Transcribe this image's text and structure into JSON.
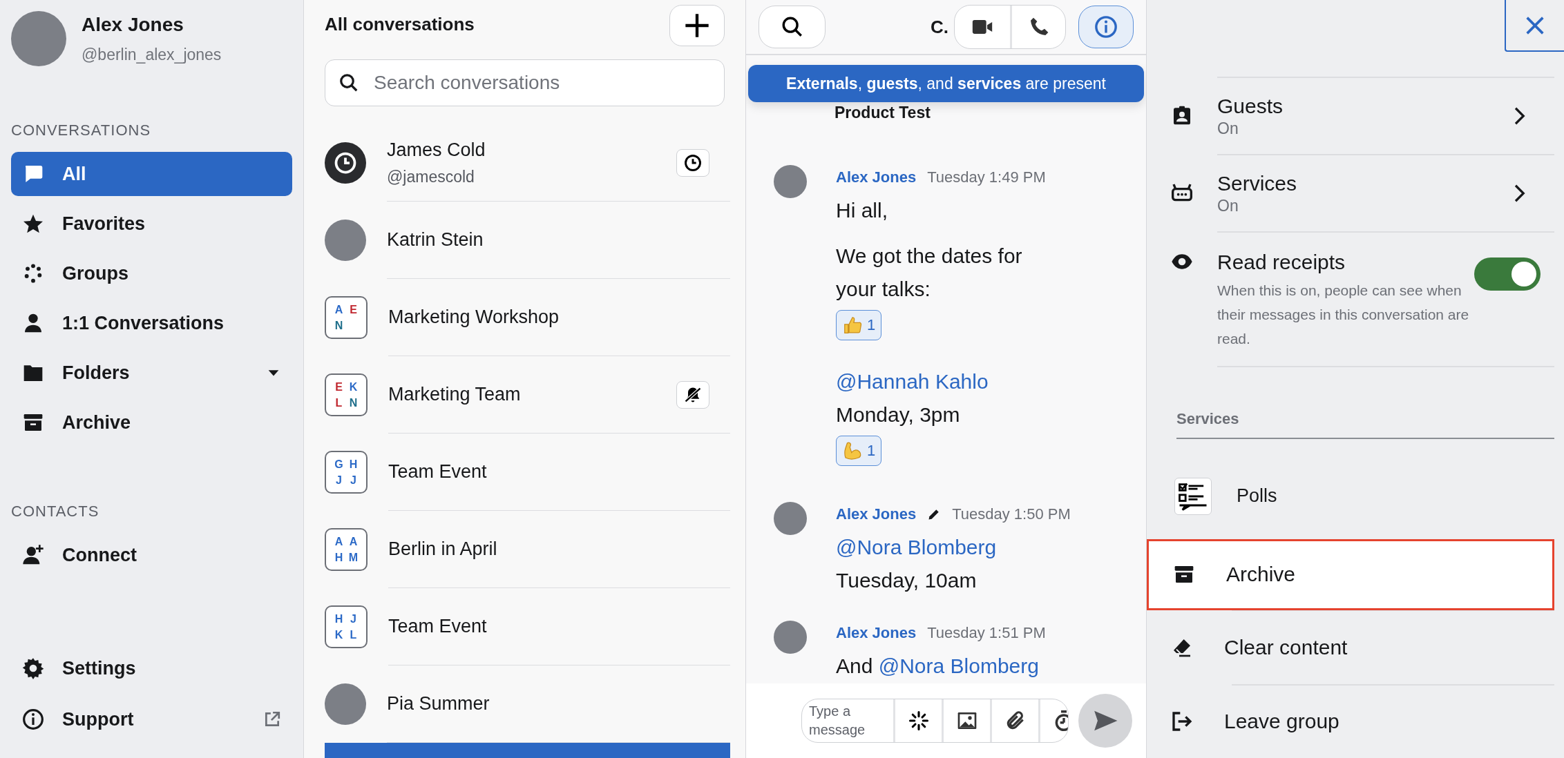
{
  "profile": {
    "name": "Alex Jones",
    "handle": "@berlin_alex_jones"
  },
  "sidebar": {
    "sections": [
      {
        "title": "CONVERSATIONS",
        "items": [
          {
            "label": "All",
            "kind": "all",
            "selected": true
          },
          {
            "label": "Favorites",
            "kind": "favorites",
            "selected": false
          },
          {
            "label": "Groups",
            "kind": "groups",
            "selected": false
          },
          {
            "label": "1:1 Conversations",
            "kind": "one_to_one",
            "selected": false
          },
          {
            "label": "Folders",
            "kind": "folders",
            "selected": false
          },
          {
            "label": "Archive",
            "kind": "archive",
            "selected": false
          }
        ]
      },
      {
        "title": "CONTACTS",
        "items": [
          {
            "label": "Connect",
            "kind": "connect",
            "selected": false
          }
        ]
      }
    ],
    "footer": [
      {
        "label": "Settings",
        "kind": "settings"
      },
      {
        "label": "Support",
        "kind": "support"
      }
    ]
  },
  "conversations": {
    "title": "All conversations",
    "search": {
      "placeholder": "Search conversations"
    },
    "items": [
      {
        "name": "James Cold",
        "handle": "@jamescold",
        "avatar": {
          "kind": "clock"
        },
        "badge": {
          "kind": "timer"
        },
        "selected": false
      },
      {
        "name": "Katrin Stein",
        "avatar": {
          "kind": "photo"
        },
        "selected": false
      },
      {
        "name": "Marketing Workshop",
        "avatar": {
          "kind": "initials"
        },
        "letters": [
          {
            "text": "A",
            "color": "#2c6ac7"
          },
          {
            "text": "E",
            "color": "#c0262e"
          },
          {
            "text": "N",
            "color": "#1f6f8b"
          }
        ],
        "selected": false
      },
      {
        "name": "Marketing Team",
        "avatar": {
          "kind": "initials"
        },
        "letters": [
          {
            "text": "E",
            "color": "#c0262e"
          },
          {
            "text": "K",
            "color": "#2c6ac7"
          },
          {
            "text": "L",
            "color": "#c0262e"
          },
          {
            "text": "N",
            "color": "#1f6f8b"
          }
        ],
        "badge": {
          "kind": "muted"
        },
        "selected": false
      },
      {
        "name": "Team Event",
        "avatar": {
          "kind": "initials"
        },
        "letters": [
          {
            "text": "G",
            "color": "#2c6ac7"
          },
          {
            "text": "H",
            "color": "#2c6ac7"
          },
          {
            "text": "J",
            "color": "#2c6ac7"
          },
          {
            "text": "J",
            "color": "#2c6ac7"
          }
        ],
        "selected": false
      },
      {
        "name": "Berlin in April",
        "avatar": {
          "kind": "initials"
        },
        "letters": [
          {
            "text": "A",
            "color": "#2c6ac7"
          },
          {
            "text": "A",
            "color": "#2c6ac7"
          },
          {
            "text": "H",
            "color": "#2c6ac7"
          },
          {
            "text": "M",
            "color": "#2c6ac7"
          }
        ],
        "selected": false
      },
      {
        "name": "Team Event",
        "avatar": {
          "kind": "initials"
        },
        "letters": [
          {
            "text": "H",
            "color": "#2c6ac7"
          },
          {
            "text": "J",
            "color": "#2c6ac7"
          },
          {
            "text": "K",
            "color": "#2c6ac7"
          },
          {
            "text": "L",
            "color": "#2c6ac7"
          }
        ],
        "selected": false
      },
      {
        "name": "Pia Summer",
        "avatar": {
          "kind": "photo"
        },
        "selected": false
      },
      {
        "selected": true
      }
    ]
  },
  "chat": {
    "title": "C.",
    "info_selected": true,
    "banner": "**Externals**, **guests**, and **services** are present",
    "messages": [
      {
        "kind": "system",
        "text": "Product Test"
      },
      {
        "kind": "user",
        "author": "Alex Jones",
        "time": "Tuesday 1:49 PM",
        "edited": false,
        "blocks": [
          {
            "kind": "text",
            "text": "Hi all,"
          },
          {
            "kind": "text",
            "text": "We got the dates for your talks:"
          },
          {
            "kind": "reaction",
            "emoji": {
              "kind": "thumbs_up"
            },
            "count": "1"
          },
          {
            "kind": "mention",
            "text": "@Hannah Kahlo"
          },
          {
            "kind": "text",
            "text": "Monday, 3pm"
          },
          {
            "kind": "reaction",
            "emoji": {
              "kind": "flexed_arm"
            },
            "count": "1"
          }
        ]
      },
      {
        "kind": "user",
        "author": "Alex Jones",
        "time": "Tuesday 1:50 PM",
        "edited": true,
        "blocks": [
          {
            "kind": "mention",
            "text": "@Nora Blomberg"
          },
          {
            "kind": "text",
            "text": "Tuesday, 10am"
          }
        ]
      },
      {
        "kind": "user",
        "author": "Alex Jones",
        "time": "Tuesday 1:51 PM",
        "edited": false,
        "blocks": [
          {
            "kind": "text_mention",
            "text": "And",
            "mention": "@Nora Blomberg"
          }
        ]
      }
    ],
    "composer": {
      "placeholder": "Type a message"
    }
  },
  "details": {
    "rows": [
      {
        "kind": "nav",
        "label": "Guests",
        "value": "On"
      },
      {
        "kind": "nav",
        "label": "Services",
        "value": "On"
      },
      {
        "kind": "toggle",
        "label": "Read receipts",
        "on": true,
        "description": "When this is on, people can see when their messages in this conversation are read."
      }
    ],
    "section": "Services",
    "services": [
      {
        "label": "Polls"
      }
    ],
    "actions": [
      {
        "label": "Archive",
        "kind": "archive",
        "highlighted": true
      },
      {
        "label": "Clear content",
        "kind": "clear",
        "highlighted": false
      },
      {
        "label": "Leave group",
        "kind": "leave",
        "highlighted": false
      }
    ]
  }
}
